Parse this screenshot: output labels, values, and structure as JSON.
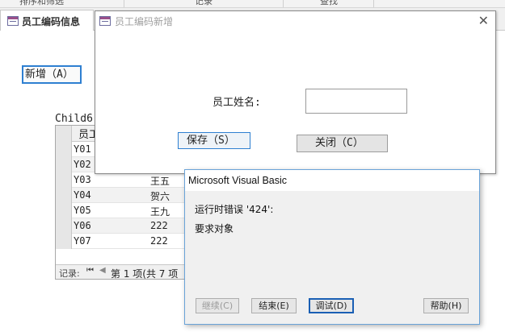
{
  "ribbon": {
    "groups": [
      "排序和筛选",
      "记录",
      "查找"
    ]
  },
  "tab": {
    "label": "员工编码信息"
  },
  "main": {
    "add_button": "新增（A）",
    "child_label": "Child6"
  },
  "datasheet": {
    "header_col1": "员工",
    "rows": [
      {
        "id": "Y01",
        "name": ""
      },
      {
        "id": "Y02",
        "name": ""
      },
      {
        "id": "Y03",
        "name": "王五"
      },
      {
        "id": "Y04",
        "name": "贺六"
      },
      {
        "id": "Y05",
        "name": "王九"
      },
      {
        "id": "Y06",
        "name": "222"
      },
      {
        "id": "Y07",
        "name": "222"
      }
    ],
    "nav_label": "记录:",
    "nav_first_icon": "first-record-icon",
    "nav_prev_icon": "prev-record-icon",
    "nav_position": "第 1 项(共 7 项"
  },
  "popup": {
    "title": "员工编码新增",
    "name_label": "员工姓名:",
    "name_value": "",
    "save_button": "保存（S）",
    "close_button": "关闭（C）"
  },
  "vb_dialog": {
    "title": "Microsoft Visual Basic",
    "error_line": "运行时错误 '424':",
    "message": "要求对象",
    "buttons": {
      "continue": "继续(C)",
      "end": "结束(E)",
      "debug": "调试(D)",
      "help": "帮助(H)"
    }
  },
  "colors": {
    "accent": "#2e7fd1",
    "dialog_border": "#6aa3d8"
  }
}
